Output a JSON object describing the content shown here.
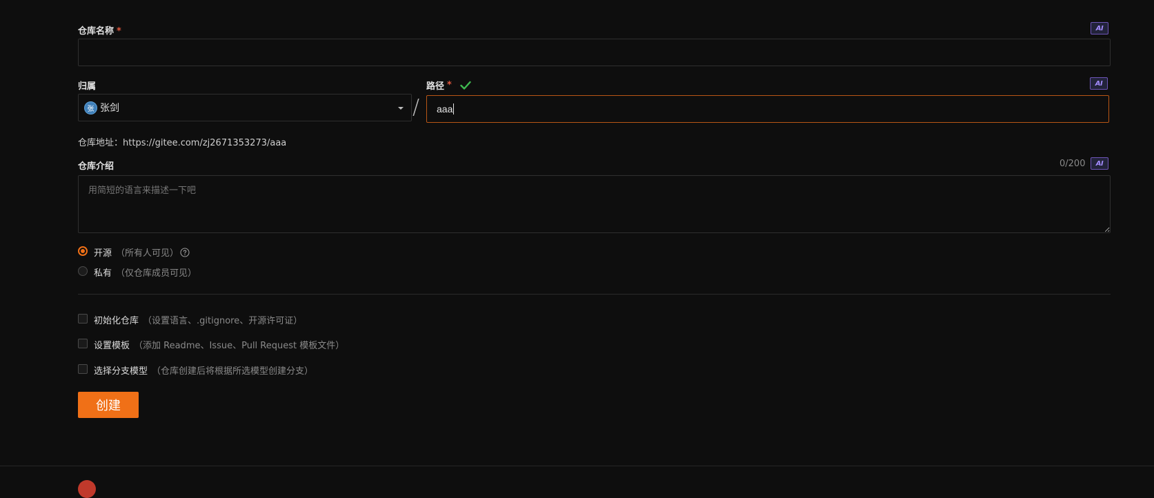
{
  "repo_name": {
    "label": "仓库名称",
    "required_mark": "*",
    "value": "",
    "ai_label": "AI"
  },
  "owner": {
    "label": "归属",
    "avatar_char": "张",
    "name": "张剑"
  },
  "separator": "/",
  "path": {
    "label": "路径",
    "required_mark": "*",
    "value": "aaa",
    "ai_label": "AI",
    "valid_icon": "check-icon"
  },
  "repo_address": {
    "prefix": "仓库地址：",
    "url": "https://gitee.com/zj2671353273/aaa"
  },
  "description": {
    "label": "仓库介绍",
    "counter": "0/200",
    "ai_label": "AI",
    "placeholder": "用简短的语言来描述一下吧"
  },
  "visibility": {
    "options": [
      {
        "label": "开源",
        "hint": "（所有人可见）",
        "selected": true,
        "help_icon": "question-circle-icon"
      },
      {
        "label": "私有",
        "hint": "（仅仓库成员可见）",
        "selected": false
      }
    ]
  },
  "extras": [
    {
      "label": "初始化仓库",
      "hint": "（设置语言、.gitignore、开源许可证）",
      "checked": false
    },
    {
      "label": "设置模板",
      "hint": "（添加 Readme、Issue、Pull Request 模板文件）",
      "checked": false
    },
    {
      "label": "选择分支模型",
      "hint": "（仓库创建后将根据所选模型创建分支）",
      "checked": false
    }
  ],
  "submit": {
    "label": "创建"
  },
  "colors": {
    "accent": "#f07017",
    "ai_badge": "#a48cff",
    "valid": "#3fb950",
    "required": "#e0573d",
    "background": "#0e0e0e"
  }
}
